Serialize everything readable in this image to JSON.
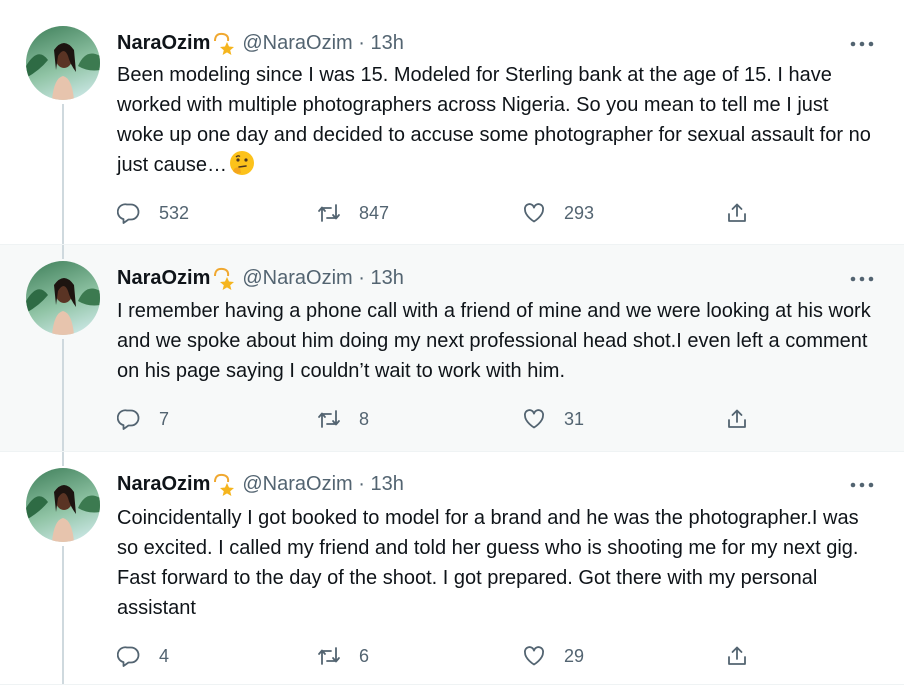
{
  "tweets": [
    {
      "name": "NaraOzim",
      "handle": "@NaraOzim",
      "separator": "·",
      "time": "13h",
      "text": "Been modeling since I was 15. Modeled for Sterling bank at the age of 15. I have worked with multiple photographers across Nigeria. So you mean to tell me I just woke up one day and decided to accuse some photographer for sexual assault for no just cause…",
      "emoji": "thinking-face",
      "replies": "532",
      "retweets": "847",
      "likes": "293"
    },
    {
      "name": "NaraOzim",
      "handle": "@NaraOzim",
      "separator": "·",
      "time": "13h",
      "text": "I remember having a phone call with a friend of mine and we were looking at his work and we spoke about him doing my next professional head shot.I even left a comment on his page saying I couldn’t wait to work with him.",
      "replies": "7",
      "retweets": "8",
      "likes": "31"
    },
    {
      "name": "NaraOzim",
      "handle": "@NaraOzim",
      "separator": "·",
      "time": "13h",
      "text": "Coincidentally I got booked to model for a brand and he was the photographer.I was so excited. I called my friend and told her guess who is shooting me for my next gig. Fast forward to the day of the shoot. I got prepared. Got there with my personal assistant",
      "replies": "4",
      "retweets": "6",
      "likes": "29"
    }
  ],
  "icons": {
    "name_badge": "dizzy-star-icon",
    "more": "more-options-icon",
    "reply": "reply-icon",
    "retweet": "retweet-icon",
    "like": "heart-icon",
    "share": "share-icon"
  },
  "colors": {
    "text": "#0f1419",
    "secondary": "#536471",
    "thread_line": "#cfd9de",
    "shaded_bg": "#f7f9f9"
  }
}
